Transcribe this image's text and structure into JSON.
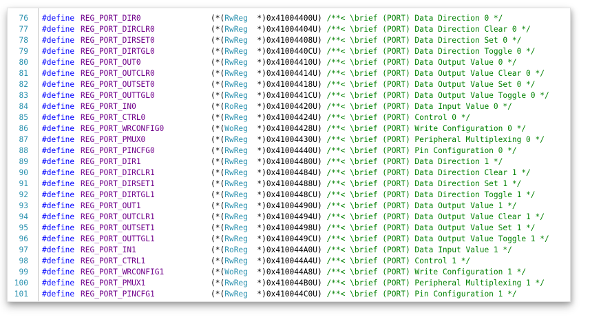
{
  "colors": {
    "line_number": "#2b91af",
    "directive": "#0000ff",
    "macro": "#6f008a",
    "type": "#2b91af",
    "comment": "#008000",
    "text": "#000000"
  },
  "lines": [
    {
      "n": "76",
      "name": "REG_PORT_DIR0",
      "type": "RwReg",
      "addr": "0x41004400U",
      "comment": "/**< \\brief (PORT) Data Direction 0 */"
    },
    {
      "n": "77",
      "name": "REG_PORT_DIRCLR0",
      "type": "RwReg",
      "addr": "0x41004404U",
      "comment": "/**< \\brief (PORT) Data Direction Clear 0 */"
    },
    {
      "n": "78",
      "name": "REG_PORT_DIRSET0",
      "type": "RwReg",
      "addr": "0x41004408U",
      "comment": "/**< \\brief (PORT) Data Direction Set 0 */"
    },
    {
      "n": "79",
      "name": "REG_PORT_DIRTGL0",
      "type": "RwReg",
      "addr": "0x4100440CU",
      "comment": "/**< \\brief (PORT) Data Direction Toggle 0 */"
    },
    {
      "n": "80",
      "name": "REG_PORT_OUT0",
      "type": "RwReg",
      "addr": "0x41004410U",
      "comment": "/**< \\brief (PORT) Data Output Value 0 */"
    },
    {
      "n": "81",
      "name": "REG_PORT_OUTCLR0",
      "type": "RwReg",
      "addr": "0x41004414U",
      "comment": "/**< \\brief (PORT) Data Output Value Clear 0 */"
    },
    {
      "n": "82",
      "name": "REG_PORT_OUTSET0",
      "type": "RwReg",
      "addr": "0x41004418U",
      "comment": "/**< \\brief (PORT) Data Output Value Set 0 */"
    },
    {
      "n": "83",
      "name": "REG_PORT_OUTTGL0",
      "type": "RwReg",
      "addr": "0x4100441CU",
      "comment": "/**< \\brief (PORT) Data Output Value Toggle 0 */"
    },
    {
      "n": "84",
      "name": "REG_PORT_IN0",
      "type": "RoReg",
      "addr": "0x41004420U",
      "comment": "/**< \\brief (PORT) Data Input Value 0 */"
    },
    {
      "n": "85",
      "name": "REG_PORT_CTRL0",
      "type": "RwReg",
      "addr": "0x41004424U",
      "comment": "/**< \\brief (PORT) Control 0 */"
    },
    {
      "n": "86",
      "name": "REG_PORT_WRCONFIG0",
      "type": "WoReg",
      "addr": "0x41004428U",
      "comment": "/**< \\brief (PORT) Write Configuration 0 */"
    },
    {
      "n": "87",
      "name": "REG_PORT_PMUX0",
      "type": "RwReg",
      "addr": "0x41004430U",
      "comment": "/**< \\brief (PORT) Peripheral Multiplexing 0 */"
    },
    {
      "n": "88",
      "name": "REG_PORT_PINCFG0",
      "type": "RwReg",
      "addr": "0x41004440U",
      "comment": "/**< \\brief (PORT) Pin Configuration 0 */"
    },
    {
      "n": "89",
      "name": "REG_PORT_DIR1",
      "type": "RwReg",
      "addr": "0x41004480U",
      "comment": "/**< \\brief (PORT) Data Direction 1 */"
    },
    {
      "n": "90",
      "name": "REG_PORT_DIRCLR1",
      "type": "RwReg",
      "addr": "0x41004484U",
      "comment": "/**< \\brief (PORT) Data Direction Clear 1 */"
    },
    {
      "n": "91",
      "name": "REG_PORT_DIRSET1",
      "type": "RwReg",
      "addr": "0x41004488U",
      "comment": "/**< \\brief (PORT) Data Direction Set 1 */"
    },
    {
      "n": "92",
      "name": "REG_PORT_DIRTGL1",
      "type": "RwReg",
      "addr": "0x4100448CU",
      "comment": "/**< \\brief (PORT) Data Direction Toggle 1 */"
    },
    {
      "n": "93",
      "name": "REG_PORT_OUT1",
      "type": "RwReg",
      "addr": "0x41004490U",
      "comment": "/**< \\brief (PORT) Data Output Value 1 */"
    },
    {
      "n": "94",
      "name": "REG_PORT_OUTCLR1",
      "type": "RwReg",
      "addr": "0x41004494U",
      "comment": "/**< \\brief (PORT) Data Output Value Clear 1 */"
    },
    {
      "n": "95",
      "name": "REG_PORT_OUTSET1",
      "type": "RwReg",
      "addr": "0x41004498U",
      "comment": "/**< \\brief (PORT) Data Output Value Set 1 */"
    },
    {
      "n": "96",
      "name": "REG_PORT_OUTTGL1",
      "type": "RwReg",
      "addr": "0x4100449CU",
      "comment": "/**< \\brief (PORT) Data Output Value Toggle 1 */"
    },
    {
      "n": "97",
      "name": "REG_PORT_IN1",
      "type": "RoReg",
      "addr": "0x410044A0U",
      "comment": "/**< \\brief (PORT) Data Input Value 1 */"
    },
    {
      "n": "98",
      "name": "REG_PORT_CTRL1",
      "type": "RwReg",
      "addr": "0x410044A4U",
      "comment": "/**< \\brief (PORT) Control 1 */"
    },
    {
      "n": "99",
      "name": "REG_PORT_WRCONFIG1",
      "type": "WoReg",
      "addr": "0x410044A8U",
      "comment": "/**< \\brief (PORT) Write Configuration 1 */"
    },
    {
      "n": "100",
      "name": "REG_PORT_PMUX1",
      "type": "RwReg",
      "addr": "0x410044B0U",
      "comment": "/**< \\brief (PORT) Peripheral Multiplexing 1 */"
    },
    {
      "n": "101",
      "name": "REG_PORT_PINCFG1",
      "type": "RwReg",
      "addr": "0x410044C0U",
      "comment": "/**< \\brief (PORT) Pin Configuration 1 */"
    }
  ],
  "tokens": {
    "directive": "#define",
    "cast_open": "(*(",
    "cast_mid": "  *)",
    "close": ")"
  }
}
